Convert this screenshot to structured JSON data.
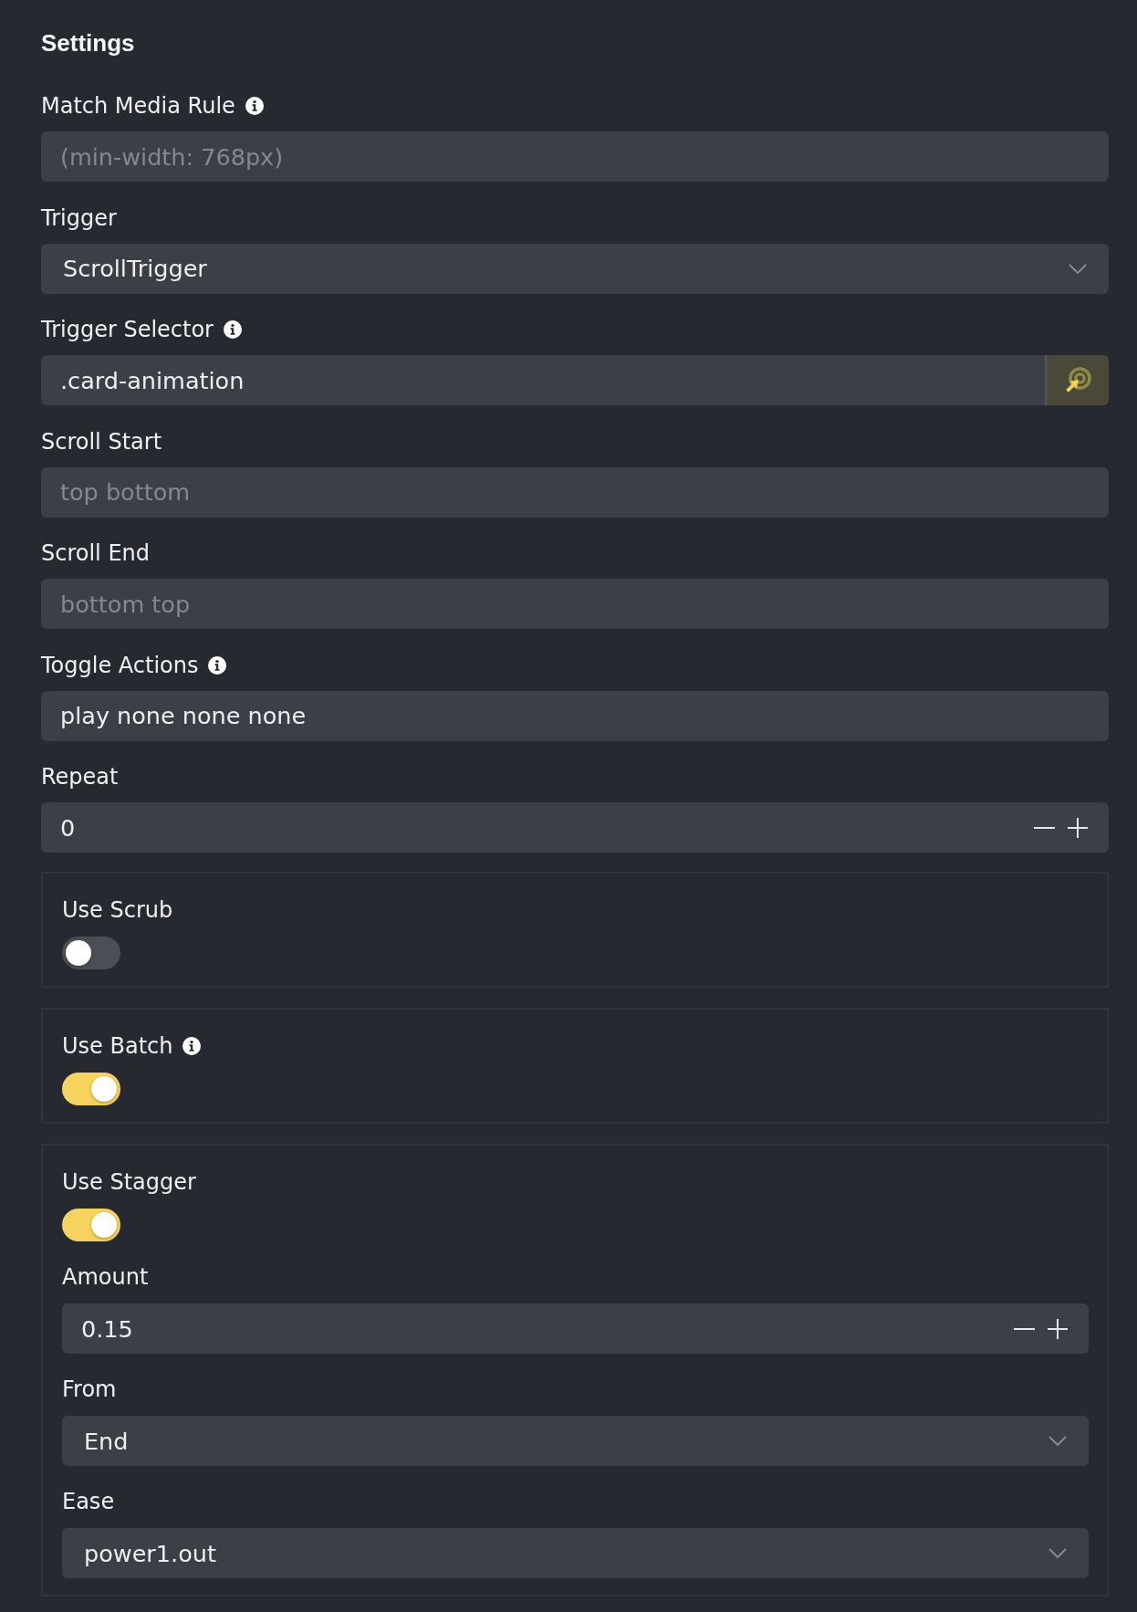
{
  "title": "Settings",
  "fields": [
    {
      "kind": "text",
      "label": "Match Media Rule",
      "info": true,
      "placeholder": "(min-width: 768px)"
    },
    {
      "kind": "select",
      "label": "Trigger",
      "info": false,
      "value": "ScrollTrigger"
    },
    {
      "kind": "picker",
      "label": "Trigger Selector",
      "info": true,
      "value": ".card-animation"
    },
    {
      "kind": "text",
      "label": "Scroll Start",
      "info": false,
      "placeholder": "top bottom"
    },
    {
      "kind": "text",
      "label": "Scroll End",
      "info": false,
      "placeholder": "bottom top"
    },
    {
      "kind": "text",
      "label": "Toggle Actions",
      "info": true,
      "value": "play none none none"
    },
    {
      "kind": "number",
      "label": "Repeat",
      "info": false,
      "value": "0"
    }
  ],
  "switches": [
    {
      "label": "Use Scrub",
      "info": false,
      "on": false
    },
    {
      "label": "Use Batch",
      "info": true,
      "on": true
    },
    {
      "label": "Use Stagger",
      "info": false,
      "on": true,
      "fields": [
        {
          "kind": "number",
          "label": "Amount",
          "info": false,
          "value": "0.15"
        },
        {
          "kind": "select",
          "label": "From",
          "info": false,
          "value": "End"
        },
        {
          "kind": "select",
          "label": "Ease",
          "info": false,
          "value": "power1.out"
        }
      ]
    }
  ]
}
